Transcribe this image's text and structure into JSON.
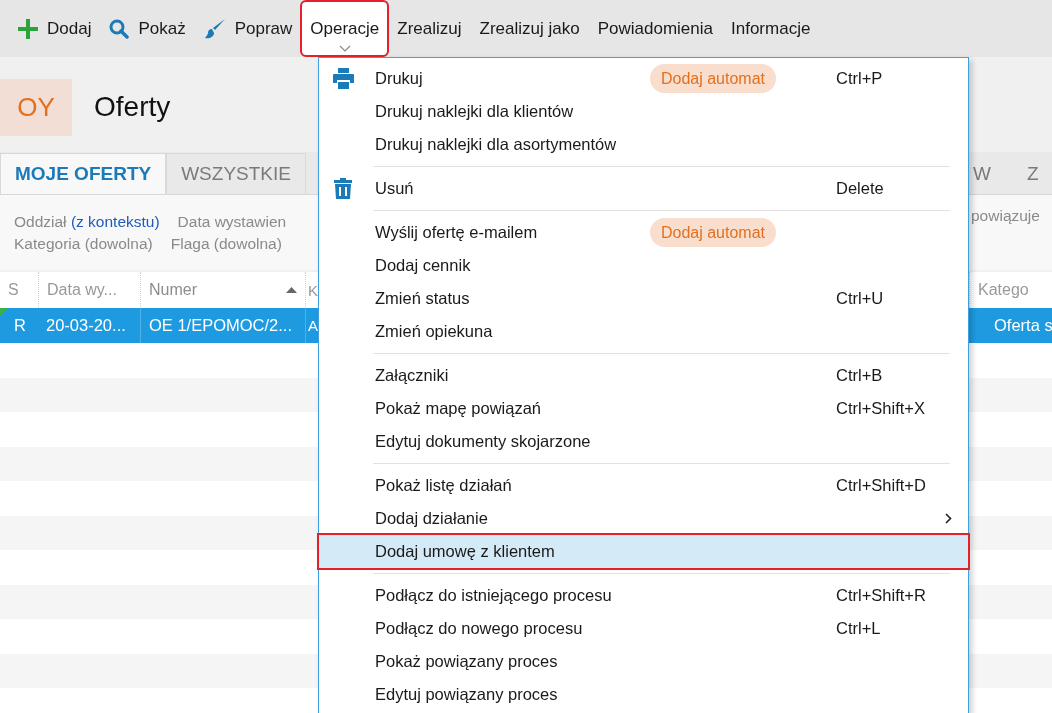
{
  "toolbar": [
    {
      "label": "Dodaj",
      "open": false
    },
    {
      "label": "Pokaż",
      "open": false
    },
    {
      "label": "Popraw",
      "open": false
    },
    {
      "label": "Operacje",
      "open": true
    },
    {
      "label": "Zrealizuj",
      "open": false
    },
    {
      "label": "Zrealizuj jako",
      "open": false
    },
    {
      "label": "Powiadomienia",
      "open": false
    },
    {
      "label": "Informacje",
      "open": false
    }
  ],
  "header": {
    "badge": "OY",
    "title": "Oferty"
  },
  "tabs": {
    "left": [
      {
        "label": "MOJE OFERTY",
        "selected": true
      },
      {
        "label": "WSZYSTKIE",
        "selected": false
      }
    ],
    "right": [
      {
        "label": "W",
        "selected": false
      },
      {
        "label": "Z",
        "selected": false
      }
    ]
  },
  "filters": {
    "left": [
      [
        {
          "label": "Oddział",
          "value": "(z kontekstu)"
        },
        {
          "label": "Data wystawien"
        }
      ],
      [
        {
          "label": "Kategoria (dowolna)"
        },
        {
          "label": "Flaga (dowolna)"
        }
      ]
    ],
    "right": [
      "powiązuje"
    ]
  },
  "table": {
    "columns": [
      {
        "label": "S",
        "sorted": false
      },
      {
        "label": "Data wy...",
        "sorted": false
      },
      {
        "label": "Numer",
        "sorted": true
      },
      {
        "label": "K",
        "sorted": false
      }
    ],
    "right_column": "Katego",
    "rows": [
      {
        "cells": [
          "R",
          "20-03-20...",
          "OE 1/EPOMOC/2...",
          "A"
        ],
        "right_cell": "Oferta s",
        "selected": true
      }
    ]
  },
  "menu": {
    "groups": [
      {
        "items": [
          {
            "label": "Drukuj",
            "badge": "Dodaj automat",
            "shortcut": "Ctrl+P",
            "submenu": false,
            "selected": false
          },
          {
            "label": "Drukuj naklejki dla klientów",
            "submenu": false,
            "selected": false
          },
          {
            "label": "Drukuj naklejki dla asortymentów",
            "submenu": false,
            "selected": false
          }
        ]
      },
      {
        "items": [
          {
            "label": "Usuń",
            "shortcut": "Delete",
            "submenu": false,
            "selected": false
          }
        ]
      },
      {
        "items": [
          {
            "label": "Wyślij ofertę e-mailem",
            "badge": "Dodaj automat",
            "submenu": false,
            "selected": false
          },
          {
            "label": "Dodaj cennik",
            "submenu": false,
            "selected": false
          },
          {
            "label": "Zmień status",
            "shortcut": "Ctrl+U",
            "submenu": false,
            "selected": false
          },
          {
            "label": "Zmień opiekuna",
            "submenu": false,
            "selected": false
          }
        ]
      },
      {
        "items": [
          {
            "label": "Załączniki",
            "shortcut": "Ctrl+B",
            "submenu": false,
            "selected": false
          },
          {
            "label": "Pokaż mapę powiązań",
            "shortcut": "Ctrl+Shift+X",
            "submenu": false,
            "selected": false
          },
          {
            "label": "Edytuj dokumenty skojarzone",
            "submenu": false,
            "selected": false
          }
        ]
      },
      {
        "items": [
          {
            "label": "Pokaż listę działań",
            "shortcut": "Ctrl+Shift+D",
            "submenu": false,
            "selected": false
          },
          {
            "label": "Dodaj działanie",
            "submenu": true,
            "selected": false
          },
          {
            "label": "Dodaj umowę z klientem",
            "submenu": false,
            "selected": true
          }
        ]
      },
      {
        "items": [
          {
            "label": "Podłącz do istniejącego procesu",
            "shortcut": "Ctrl+Shift+R",
            "submenu": false,
            "selected": false
          },
          {
            "label": "Podłącz do nowego procesu",
            "shortcut": "Ctrl+L",
            "submenu": false,
            "selected": false
          },
          {
            "label": "Pokaż powiązany proces",
            "submenu": false,
            "selected": false
          },
          {
            "label": "Edytuj powiązany proces",
            "submenu": false,
            "selected": false
          }
        ]
      }
    ]
  }
}
